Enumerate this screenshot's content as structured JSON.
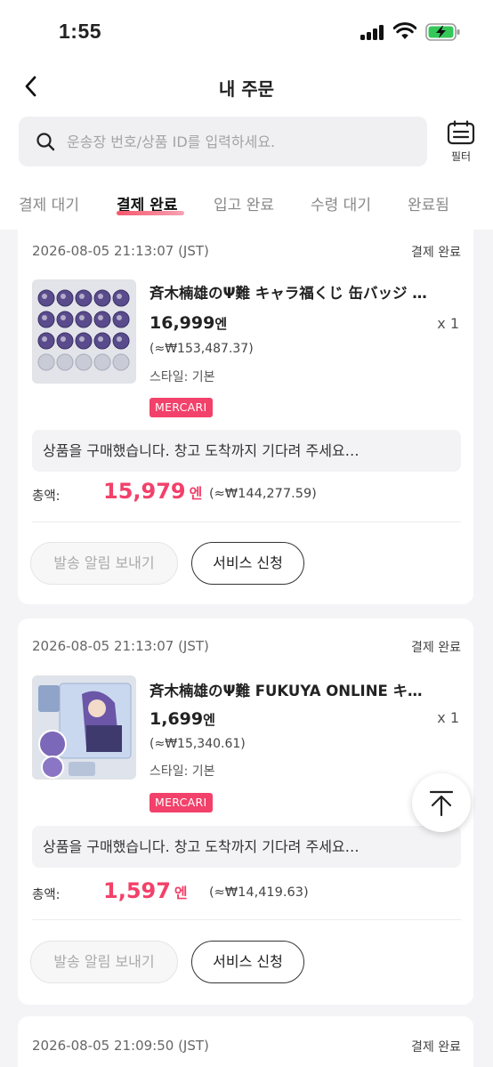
{
  "status_bar": {
    "time": "1:55"
  },
  "nav": {
    "title": "내 주문"
  },
  "search": {
    "placeholder": "운송장 번호/상품 ID를 입력하세요."
  },
  "filter": {
    "label": "필터"
  },
  "tabs": [
    {
      "label": "결제 대기",
      "active": false
    },
    {
      "label": "결제 완료",
      "active": true
    },
    {
      "label": "입고 완료",
      "active": false
    },
    {
      "label": "수령 대기",
      "active": false
    },
    {
      "label": "완료됨",
      "active": false
    }
  ],
  "orders": [
    {
      "date": "2026-08-05 21:13:07 (JST)",
      "status": "결제 완료",
      "title": "斉木楠雄のΨ難 キャラ福くじ 缶バッジ …",
      "price": "16,999",
      "price_unit": "엔",
      "qty": "x 1",
      "krw": "(≈₩153,487.37)",
      "style": "스타일: 기본",
      "source_badge": "MERCARI",
      "notice": "상품을 구매했습니다. 창고 도착까지 기다려 주세요…",
      "total_label": "총액:",
      "total": "15,979",
      "total_unit": "엔",
      "total_krw": "(≈₩144,277.59)",
      "btn_notify": "발송 알림 보내기",
      "btn_service": "서비스 신청"
    },
    {
      "date": "2026-08-05 21:13:07 (JST)",
      "status": "결제 완료",
      "title": "斉木楠雄のΨ難 FUKUYA ONLINE キ…",
      "price": "1,699",
      "price_unit": "엔",
      "qty": "x 1",
      "krw": "(≈₩15,340.61)",
      "style": "스타일: 기본",
      "source_badge": "MERCARI",
      "notice": "상품을 구매했습니다. 창고 도착까지 기다려 주세요…",
      "total_label": "총액:",
      "total": "1,597",
      "total_unit": "엔",
      "total_krw": "(≈₩14,419.63)",
      "btn_notify": "발송 알림 보내기",
      "btn_service": "서비스 신청"
    },
    {
      "date": "2026-08-05 21:09:50 (JST)",
      "status": "결제 완료"
    }
  ],
  "colors": {
    "accent": "#f2416a",
    "background": "#f4f4f6"
  }
}
